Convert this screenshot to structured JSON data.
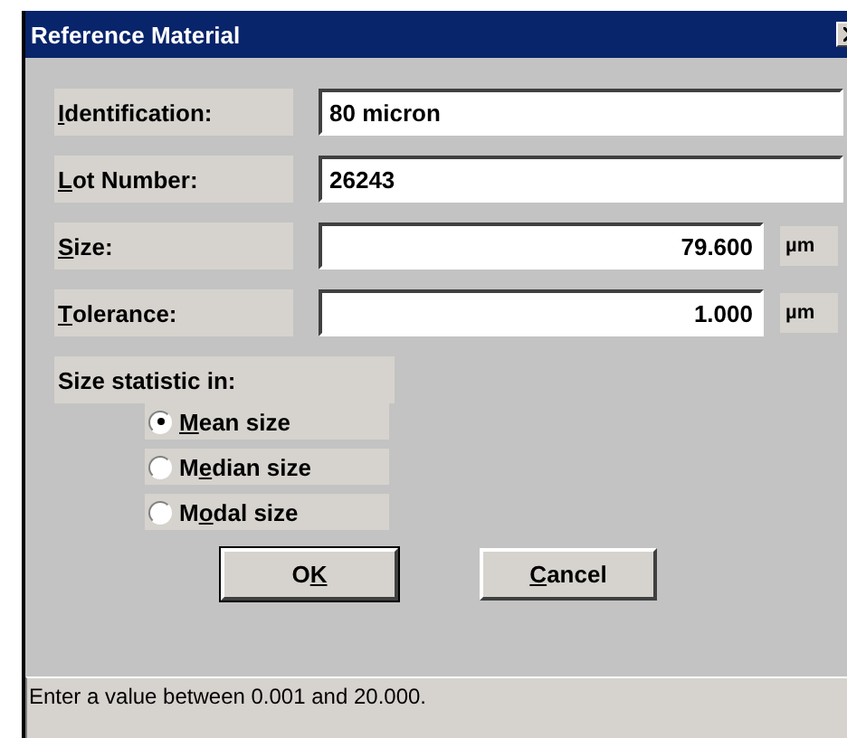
{
  "window": {
    "title": "Reference Material"
  },
  "fields": [
    {
      "label": {
        "key": "I",
        "post": "dentification:"
      },
      "value": "80 micron",
      "kind": "text"
    },
    {
      "label": {
        "key": "L",
        "post": "ot Number:"
      },
      "value": "26243",
      "kind": "text"
    },
    {
      "label": {
        "key": "S",
        "post": "ize:"
      },
      "value": "79.600",
      "kind": "number",
      "unit": "µm"
    },
    {
      "label": {
        "key": "T",
        "post": "olerance:"
      },
      "value": "1.000",
      "kind": "number",
      "unit": "µm"
    }
  ],
  "statistic": {
    "label": "Size statistic in:",
    "options": [
      {
        "label": {
          "key": "M",
          "post": "ean size"
        },
        "selected": true
      },
      {
        "label": {
          "pre": "M",
          "key": "e",
          "post": "dian size"
        },
        "selected": false
      },
      {
        "label": {
          "pre": "M",
          "key": "o",
          "post": "dal size"
        },
        "selected": false
      }
    ]
  },
  "buttons": [
    {
      "label": {
        "pre": "O",
        "key": "K"
      },
      "default": true
    },
    {
      "label": {
        "key": "C",
        "post": "ancel"
      },
      "default": false
    }
  ],
  "status_bar": "Enter a value between 0.001 and 20.000."
}
